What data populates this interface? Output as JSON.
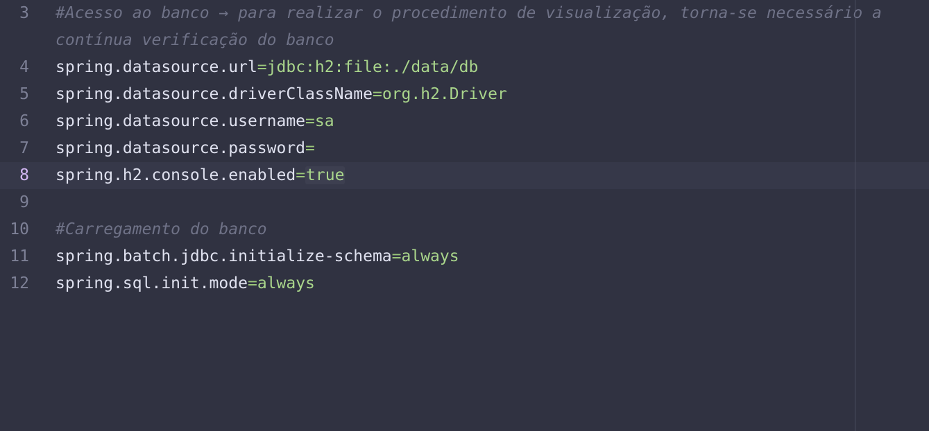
{
  "editor": {
    "lines": [
      {
        "num": "3",
        "type": "comment",
        "text": "#Acesso ao banco → para realizar o procedimento de visualização, torna-se necessário a"
      },
      {
        "num": "",
        "type": "comment",
        "text": "contínua verificação do banco"
      },
      {
        "num": "4",
        "type": "prop",
        "key": "spring.datasource.url",
        "eq": "=",
        "value": "jdbc:h2:file:./data/db"
      },
      {
        "num": "5",
        "type": "prop",
        "key": "spring.datasource.driverClassName",
        "eq": "=",
        "value": "org.h2.Driver"
      },
      {
        "num": "6",
        "type": "prop",
        "key": "spring.datasource.username",
        "eq": "=",
        "value": "sa"
      },
      {
        "num": "7",
        "type": "prop",
        "key": "spring.datasource.password",
        "eq": "=",
        "value": ""
      },
      {
        "num": "8",
        "type": "prop",
        "key": "spring.h2.console.enabled",
        "eq": "=",
        "value": "true",
        "current": true
      },
      {
        "num": "9",
        "type": "empty"
      },
      {
        "num": "10",
        "type": "comment",
        "text": "#Carregamento do banco"
      },
      {
        "num": "11",
        "type": "prop",
        "key": "spring.batch.jdbc.initialize-schema",
        "eq": "=",
        "value": "always"
      },
      {
        "num": "12",
        "type": "prop",
        "key": "spring.sql.init.mode",
        "eq": "=",
        "value": "always"
      }
    ]
  },
  "theme": {
    "background": "#303241",
    "comment": "#6f7287",
    "value": "#a9d58b",
    "key": "#dfe1ef",
    "active_line_number": "#d4b8f5"
  }
}
